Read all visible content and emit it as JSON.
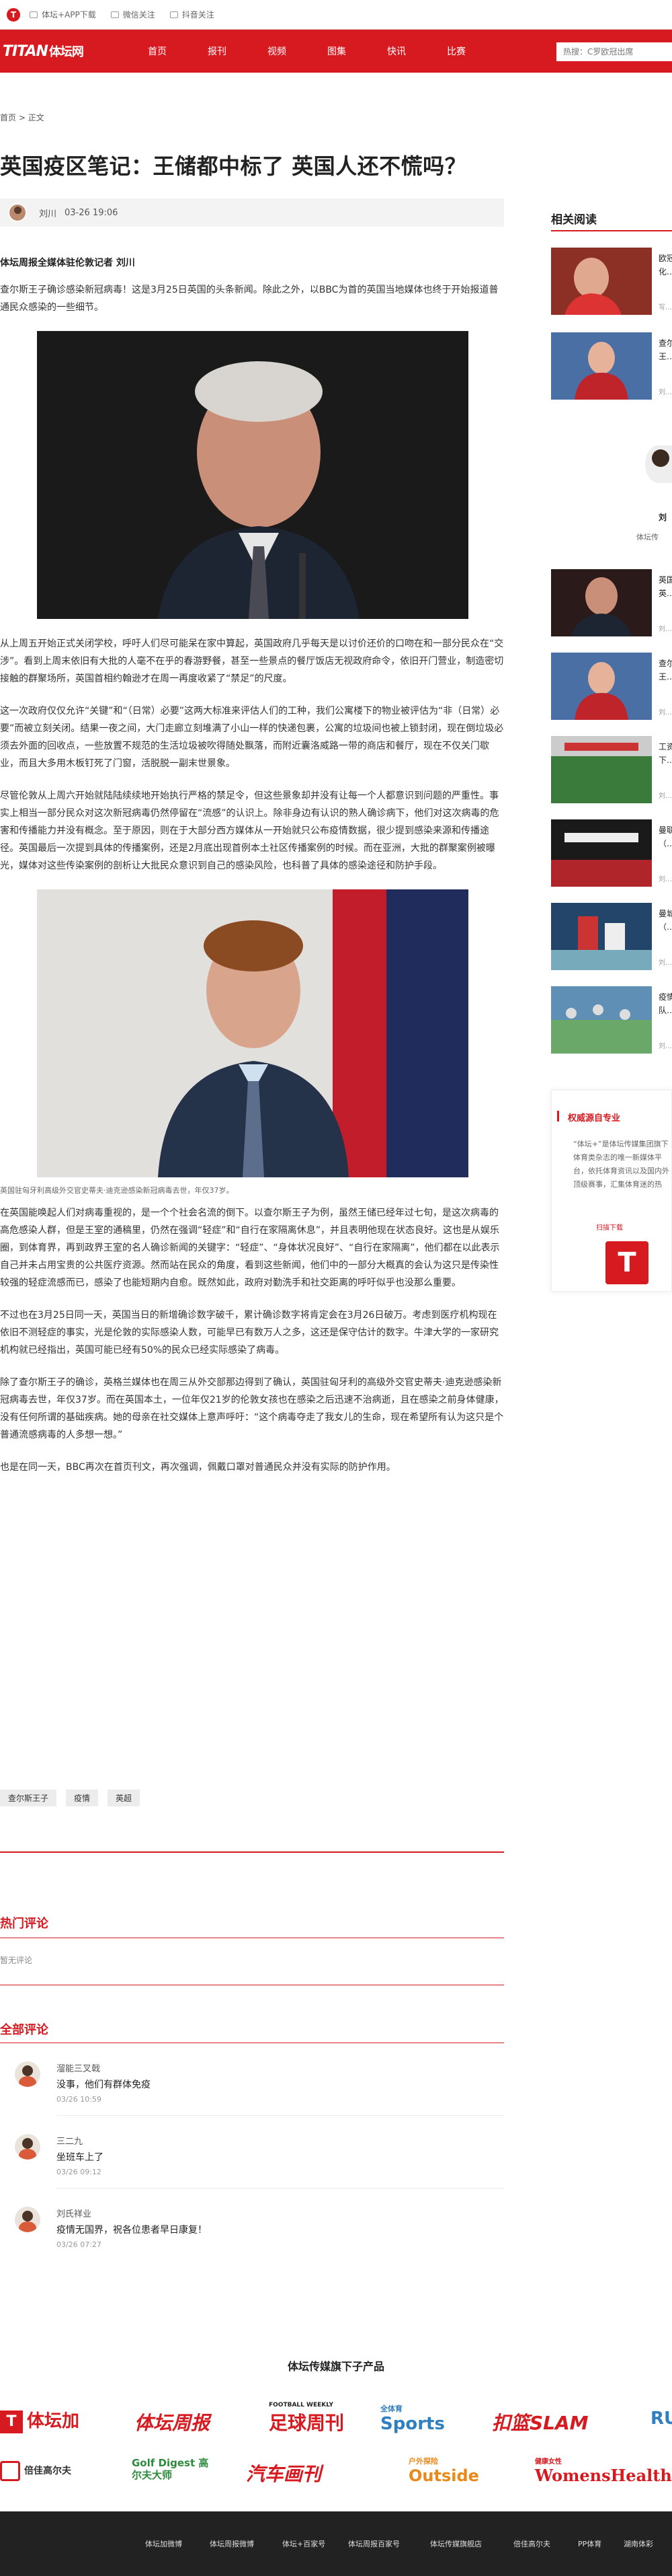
{
  "topbar": {
    "logo_letter": "T",
    "links": [
      "体坛+APP下载",
      "微信关注",
      "抖音关注"
    ]
  },
  "nav": {
    "brand_latin": "TITAN",
    "brand_cn": "体坛网",
    "items": [
      "首页",
      "报刊",
      "视频",
      "图集",
      "快讯",
      "比赛"
    ],
    "search_placeholder": "热搜：C罗欧冠出席"
  },
  "breadcrumb": {
    "home": "首页",
    "separator": " > ",
    "current": "正文"
  },
  "article": {
    "title": "英国疫区笔记：王储都中标了 英国人还不慌吗？",
    "author": "刘川",
    "datetime": "03-26 19:06",
    "byline": "体坛周报全媒体驻伦敦记者 刘川",
    "paragraphs": [
      "查尔斯王子确诊感染新冠病毒！这是3月25日英国的头条新闻。除此之外，以BBC为首的英国当地媒体也终于开始报道普通民众感染的一些细节。",
      "从上周五开始正式关闭学校，呼吁人们尽可能呆在家中算起，英国政府几乎每天是以讨价还价的口吻在和一部分民众在“交涉”。看到上周末依旧有大批的人毫不在乎的春游野餐，甚至一些景点的餐厅饭店无视政府命令，依旧开门营业，制造密切接触的群聚场所，英国首相约翰逊才在周一再度收紧了“禁足”的尺度。",
      "这一次政府仅仅允许“关键”和“（日常）必要”这两大标准来评估人们的工种，我们公寓楼下的物业被评估为“非（日常）必要”而被立刻关闭。结果一夜之间，大门走廊立刻堆满了小山一样的快递包裹，公寓的垃圾间也被上锁封闭，现在倒垃圾必须去外面的回收点，一些放置不规范的生活垃圾被吹得随处飘落，而附近囊洛威路一带的商店和餐厅，现在不仅关门歇业，而且大多用木板钉死了门窗，活脱脱一副末世景象。",
      "尽管伦敦从上周六开始就陆陆续续地开始执行严格的禁足令，但这些景象却并没有让每一个人都意识到问题的严重性。事实上相当一部分民众对这次新冠病毒仍然停留在“流感”的认识上。除非身边有认识的熟人确诊病下，他们对这次病毒的危害和传播能力并没有概念。至于原因，则在于大部分西方媒体从一开始就只公布疫情数据，很少提到感染来源和传播途径。英国最后一次提到具体的传播案例，还是2月底出现首例本土社区传播案例的时候。而在亚洲，大批的群聚案例被曝光，媒体对这些传染案例的剖析让大批民众意识到自己的感染风险，也科普了具体的感染途径和防护手段。",
      "在英国能唤起人们对病毒重视的，是一个个社会名流的倒下。以查尔斯王子为例，虽然王储已经年过七旬，是这次病毒的高危感染人群，但是王室的通稿里，仍然在强调“轻症”和“自行在家隔离休息”，并且表明他现在状态良好。这也是从娱乐圈，到体育界，再到政界王室的名人确诊新闻的关键字：“轻症”、“身体状况良好”、“自行在家隔离”，他们都在以此表示自己并未占用宝贵的公共医疗资源。然而站在民众的角度，看到这些新闻，他们中的一部分大概真的会认为这只是传染性较强的轻症流感而已，感染了也能短期内自愈。既然如此，政府对勤洗手和社交距离的呼吁似乎也没那么重要。",
      "不过也在3月25日同一天，英国当日的新增确诊数字破千，累计确诊数字将肯定会在3月26日破万。考虑到医疗机构现在依旧不测轻症的事实，光是伦敦的实际感染人数，可能早已有数万人之多，这还是保守估计的数字。牛津大学的一家研究机构就已经指出，英国可能已经有50%的民众已经实际感染了病毒。",
      "除了查尔斯王子的确诊，英格兰媒体也在周三从外交部那边得到了确认，英国驻匈牙利的高级外交官史蒂夫·迪克逊感染新冠病毒去世，年仅37岁。而在英国本土，一位年仅21岁的伦敦女孩也在感染之后迅速不治病逝，且在感染之前身体健康，没有任何所谓的基础疾病。她的母亲在社交媒体上意声呼吁：“这个病毒夺走了我女儿的生命，现在希望所有认为这只是个普通流感病毒的人多想一想。”",
      "也是在同一天，BBC再次在首页刊文，再次强调，佩戴口罩对普通民众并没有实际的防护作用。"
    ],
    "photo2_caption": "英国驻匈牙利高级外交官史蒂夫·迪克逊感染新冠病毒去世，年仅37岁。",
    "tags": [
      "查尔斯王子",
      "疫情",
      "英超"
    ]
  },
  "comments": {
    "hot_title": "热门评论",
    "hot_empty": "暂无评论",
    "all_title": "全部评论",
    "items": [
      {
        "user": "溜能三叉戟",
        "text": "没事，他们有群体免疫",
        "time": "03/26 10:59"
      },
      {
        "user": "三二九",
        "text": "坐班车上了",
        "time": "03/26 09:12"
      },
      {
        "user": "刘氏祥业",
        "text": "疫情无国界，祝各位患者早日康复！",
        "time": "03/26 07:27"
      }
    ]
  },
  "sidebar": {
    "related_title": "相关阅读",
    "related": [
      {
        "title": "欧冠…",
        "sub": "化…",
        "time": "写…"
      },
      {
        "title": "查尔…",
        "sub": "王…",
        "time": "刘…"
      }
    ],
    "author_name": "刘",
    "author_org": "体坛传",
    "author_items": [
      {
        "title": "英国…",
        "sub": "英…",
        "time": "刘…"
      },
      {
        "title": "查尔…",
        "sub": "王…",
        "time": "刘…"
      },
      {
        "title": "工资…",
        "sub": "下…",
        "time": "刘…"
      },
      {
        "title": "曼联…",
        "sub": "（…",
        "time": "刘…"
      },
      {
        "title": "曼城…",
        "sub": "（…",
        "time": "刘…"
      },
      {
        "title": "疫情…",
        "sub": "队…",
        "time": "刘…"
      }
    ],
    "media_title": "权威源自专业",
    "media_text": "“体坛+”是体坛传媒集团旗下体育类杂志的唯一新媒体平台，依托体育资讯以及国内外顶级赛事，汇集体育迷的热点，是一款移动互联网时代的必备应用。",
    "media_link": "扫描下载",
    "media_logo": "T"
  },
  "brands": {
    "title": "体坛传媒旗下子产品",
    "row1": [
      "体坛加",
      "体坛周报",
      "足球周刊",
      "Sports",
      "扣篮SLAM",
      "RU"
    ],
    "row1_sub": [
      "",
      "",
      "FOOTBALL WEEKLY",
      "全体育",
      "",
      ""
    ],
    "row2": [
      "倍佳高尔夫",
      "Golf Digest 高尔夫大师",
      "汽车画刊",
      "Outside",
      "WomensHealth"
    ],
    "row2_sub": [
      "",
      "",
      "",
      "户外探险",
      "健康女性"
    ]
  },
  "footer": {
    "links": [
      "体坛加微博",
      "体坛周报微博",
      "体坛+百家号",
      "体坛周报百家号",
      "体坛传媒旗舰店",
      "倍佳高尔夫",
      "PP体育",
      "湖南体彩"
    ]
  },
  "colors": {
    "brand_red": "#d71920",
    "footer_bg": "#222222"
  }
}
